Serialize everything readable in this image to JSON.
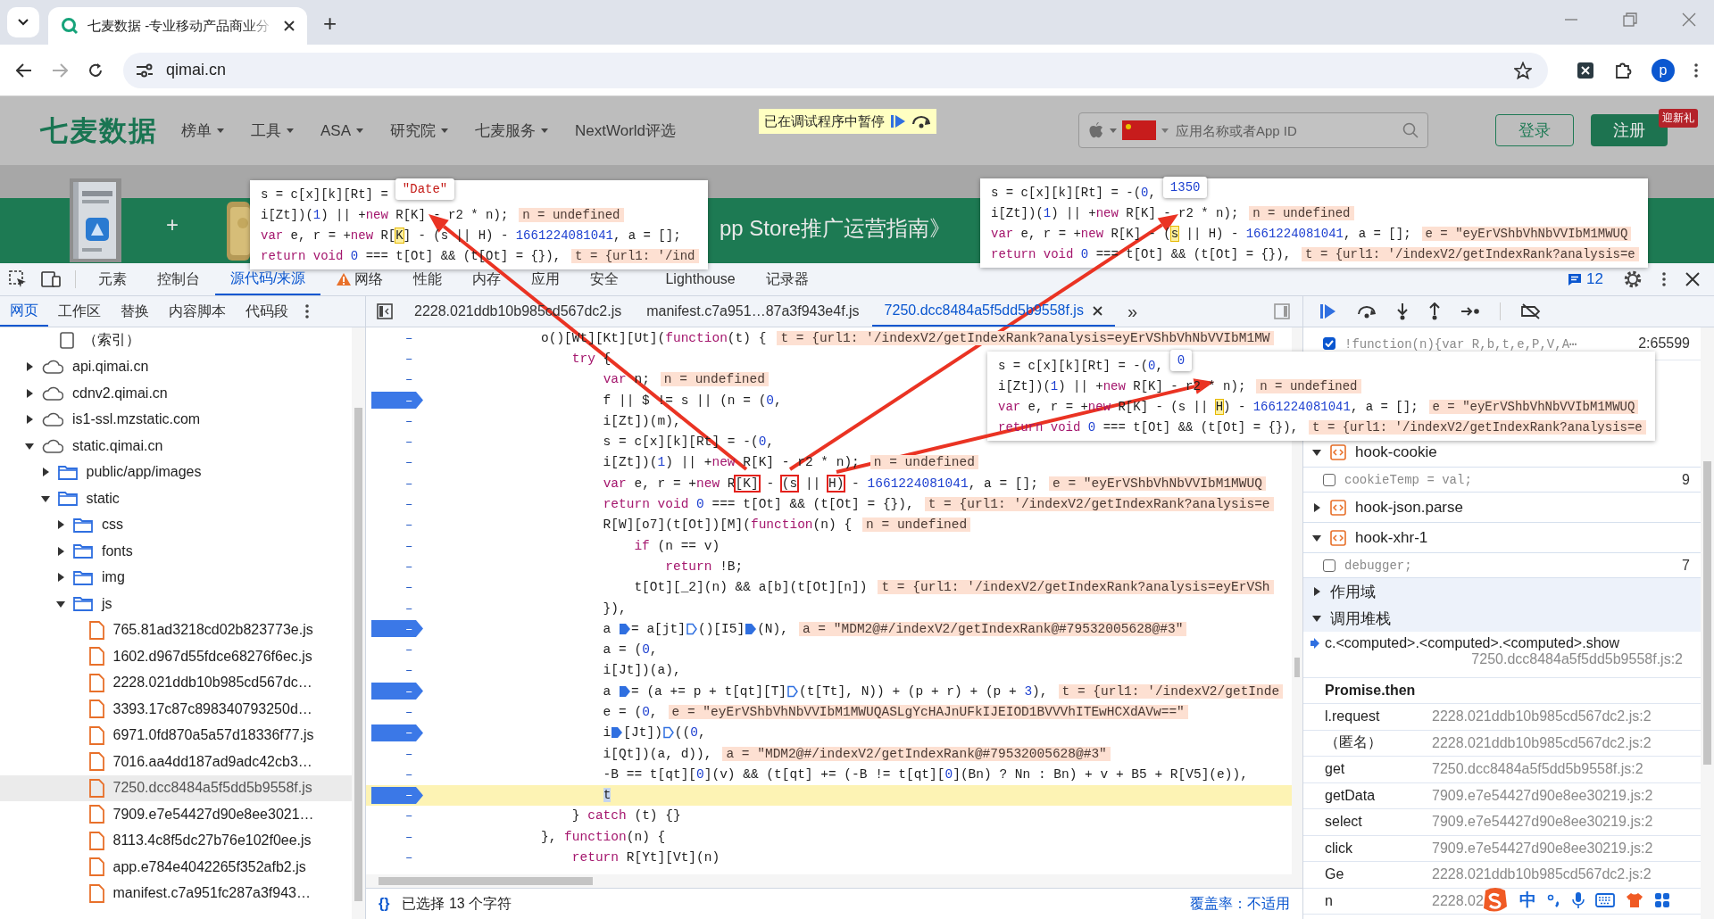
{
  "browser": {
    "tab": {
      "title": "七麦数据 -专业移动产品商业分"
    },
    "new_tab": "+",
    "address": "qimai.cn",
    "profile": "p"
  },
  "site": {
    "logo": "七麦数据",
    "nav": [
      {
        "label": "榜单",
        "dropdown": true
      },
      {
        "label": "工具",
        "dropdown": true
      },
      {
        "label": "ASA",
        "dropdown": true
      },
      {
        "label": "研究院",
        "dropdown": true
      },
      {
        "label": "七麦服务",
        "dropdown": true
      },
      {
        "label": "NextWorld评选",
        "dropdown": false
      }
    ],
    "paused_banner": "已在调试程序中暂停",
    "search": {
      "placeholder": "应用名称或者App ID"
    },
    "login": "登录",
    "register": "注册",
    "register_badge": "迎新礼",
    "banner_plus": "+",
    "banner_title": "pp Store推广运营指南》"
  },
  "devtools": {
    "tabs": [
      {
        "label": "元素",
        "selected": false,
        "warning": false
      },
      {
        "label": "控制台",
        "selected": false,
        "warning": false
      },
      {
        "label": "源代码/来源",
        "selected": true,
        "warning": false
      },
      {
        "label": "网络",
        "selected": false,
        "warning": true
      },
      {
        "label": "性能",
        "selected": false,
        "warning": false
      },
      {
        "label": "内存",
        "selected": false,
        "warning": false
      },
      {
        "label": "应用",
        "selected": false,
        "warning": false
      },
      {
        "label": "安全",
        "selected": false,
        "warning": false
      },
      {
        "label": "Lighthouse",
        "selected": false,
        "warning": false
      },
      {
        "label": "记录器",
        "selected": false,
        "warning": false
      }
    ],
    "issues_count": "12"
  },
  "navigator": {
    "tabs": [
      {
        "label": "网页",
        "selected": true
      },
      {
        "label": "工作区",
        "selected": false
      },
      {
        "label": "替换",
        "selected": false
      },
      {
        "label": "内容脚本",
        "selected": false
      },
      {
        "label": "代码段",
        "selected": false
      }
    ],
    "tree": [
      {
        "label": "（索引）",
        "kind": "page",
        "selected": false
      },
      {
        "label": "api.qimai.cn",
        "kind": "domain",
        "expanded": false,
        "selected": false
      },
      {
        "label": "cdnv2.qimai.cn",
        "kind": "domain",
        "expanded": false,
        "selected": false
      },
      {
        "label": "is1-ssl.mzstatic.com",
        "kind": "domain",
        "expanded": false,
        "selected": false
      },
      {
        "label": "static.qimai.cn",
        "kind": "domain",
        "expanded": true,
        "selected": false,
        "children": [
          {
            "label": "public/app/images",
            "kind": "folder",
            "expanded": false,
            "selected": false
          },
          {
            "label": "static",
            "kind": "folder",
            "expanded": true,
            "selected": false,
            "children": [
              {
                "label": "css",
                "kind": "folder",
                "expanded": false,
                "selected": false
              },
              {
                "label": "fonts",
                "kind": "folder",
                "expanded": false,
                "selected": false
              },
              {
                "label": "img",
                "kind": "folder",
                "expanded": false,
                "selected": false
              },
              {
                "label": "js",
                "kind": "folder",
                "expanded": true,
                "selected": false,
                "children": [
                  {
                    "label": "765.81ad3218cd02b823773e.js",
                    "kind": "file",
                    "selected": false
                  },
                  {
                    "label": "1602.d967d55fdce68276f6ec.js",
                    "kind": "file",
                    "selected": false
                  },
                  {
                    "label": "2228.021ddb10b985cd567dc…",
                    "kind": "file",
                    "selected": false
                  },
                  {
                    "label": "3393.17c87c898340793250d…",
                    "kind": "file",
                    "selected": false
                  },
                  {
                    "label": "6971.0fd870a5a57d18336f77.js",
                    "kind": "file",
                    "selected": false
                  },
                  {
                    "label": "7016.aa4dd187ad9adc42cb3…",
                    "kind": "file",
                    "selected": false
                  },
                  {
                    "label": "7250.dcc8484a5f5dd5b9558f.js",
                    "kind": "file",
                    "selected": true
                  },
                  {
                    "label": "7909.e7e54427d90e8ee3021…",
                    "kind": "file",
                    "selected": false
                  },
                  {
                    "label": "8113.4c8f5dc27b76e102f0ee.js",
                    "kind": "file",
                    "selected": false
                  },
                  {
                    "label": "app.e784e4042265f352afb2.js",
                    "kind": "file",
                    "selected": false
                  },
                  {
                    "label": "manifest.c7a951fc287a3f943…",
                    "kind": "file",
                    "selected": false
                  }
                ]
              }
            ]
          }
        ]
      }
    ]
  },
  "editor": {
    "tabs": [
      {
        "label": "2228.021ddb10b985cd567dc2.js",
        "selected": false
      },
      {
        "label": "manifest.c7a951…87a3f943e4f.js",
        "selected": false
      },
      {
        "label": "7250.dcc8484a5f5dd5b9558f.js",
        "selected": true
      }
    ],
    "more": "»",
    "lines": [
      {
        "num": "–",
        "bp": false,
        "current": false,
        "code": [
          {
            "t": "o()[Wt][Kt][Ut]("
          },
          {
            "t": "function",
            "kind": "kw"
          },
          {
            "t": "(t) {"
          }
        ],
        "value": "t = {url1: '/indexV2/getIndexRank?analysis=eyErVShbVhNbVVIbM1MW"
      },
      {
        "num": "–",
        "bp": false,
        "current": false,
        "code": [
          {
            "t": "    try",
            "kind": "kw"
          },
          {
            "t": " {"
          }
        ]
      },
      {
        "num": "–",
        "bp": false,
        "current": false,
        "code": [
          {
            "t": "        var",
            "kind": "kw"
          },
          {
            "t": " n;"
          }
        ],
        "value": "n = undefined"
      },
      {
        "num": "–",
        "bp": true,
        "current": false,
        "code": [
          {
            "t": "        f || $ != s || (n = ("
          },
          {
            "t": "0",
            "kind": "num"
          },
          {
            "t": ","
          }
        ]
      },
      {
        "num": "–",
        "bp": false,
        "current": false,
        "code": [
          {
            "t": "        i[Zt])(m),"
          }
        ]
      },
      {
        "num": "–",
        "bp": false,
        "current": false,
        "code": [
          {
            "t": "        s = c[x][k][Rt] = -("
          },
          {
            "t": "0",
            "kind": "num"
          },
          {
            "t": ","
          }
        ]
      },
      {
        "num": "–",
        "bp": false,
        "current": false,
        "code": [
          {
            "t": "        i[Zt])("
          },
          {
            "t": "1",
            "kind": "num"
          },
          {
            "t": ") || +"
          },
          {
            "t": "new",
            "kind": "kw"
          },
          {
            "t": " R[K] - r2 * n);"
          }
        ],
        "value": "n = undefined"
      },
      {
        "num": "–",
        "bp": false,
        "current": false,
        "code": [
          {
            "t": "        var",
            "kind": "kw"
          },
          {
            "t": " e, r = +"
          },
          {
            "t": "new",
            "kind": "kw"
          },
          {
            "t": " R"
          },
          {
            "t": "[K]",
            "kind": "box"
          },
          {
            "t": " - "
          },
          {
            "t": "(s",
            "kind": "box"
          },
          {
            "t": " || "
          },
          {
            "t": "H)",
            "kind": "box"
          },
          {
            "t": " - "
          },
          {
            "t": "1661224081041",
            "kind": "num"
          },
          {
            "t": ", a = [];"
          }
        ],
        "value": "e = \"eyErVShbVhNbVVIbM1MWUQ"
      },
      {
        "num": "–",
        "bp": false,
        "current": false,
        "code": [
          {
            "t": "        return void",
            "kind": "kw"
          },
          {
            "t": " 0",
            "kind": "num"
          },
          {
            "t": " === t[Ot] && (t[Ot] = {}),"
          }
        ],
        "value": "t = {url1: '/indexV2/getIndexRank?analysis=e"
      },
      {
        "num": "–",
        "bp": false,
        "current": false,
        "code": [
          {
            "t": "        R[W][o7](t[Ot])[M]("
          },
          {
            "t": "function",
            "kind": "kw"
          },
          {
            "t": "(n) {"
          }
        ],
        "value": "n = undefined"
      },
      {
        "num": "–",
        "bp": false,
        "current": false,
        "code": [
          {
            "t": "            if",
            "kind": "kw"
          },
          {
            "t": " (n == v)"
          }
        ]
      },
      {
        "num": "–",
        "bp": false,
        "current": false,
        "code": [
          {
            "t": "                return",
            "kind": "kw"
          },
          {
            "t": " !B;"
          }
        ]
      },
      {
        "num": "–",
        "bp": false,
        "current": false,
        "code": [
          {
            "t": "            t[Ot][_2](n) && a[b](t[Ot][n])"
          }
        ],
        "value": "t = {url1: '/indexV2/getIndexRank?analysis=eyErVSh"
      },
      {
        "num": "–",
        "bp": false,
        "current": false,
        "code": [
          {
            "t": "        }),"
          }
        ]
      },
      {
        "num": "–",
        "bp": true,
        "current": false,
        "code": [
          {
            "t": "        a "
          },
          {
            "kind": "step"
          },
          {
            "t": "= a[jt]"
          },
          {
            "kind": "step-open"
          },
          {
            "t": "()[I5]"
          },
          {
            "kind": "step"
          },
          {
            "t": "(N),"
          }
        ],
        "value": "a = \"MDM2@#/indexV2/getIndexRank@#79532005628@#3\""
      },
      {
        "num": "–",
        "bp": false,
        "current": false,
        "code": [
          {
            "t": "        a = ("
          },
          {
            "t": "0",
            "kind": "num"
          },
          {
            "t": ","
          }
        ]
      },
      {
        "num": "–",
        "bp": false,
        "current": false,
        "code": [
          {
            "t": "        i[Jt])(a),"
          }
        ]
      },
      {
        "num": "–",
        "bp": true,
        "current": false,
        "code": [
          {
            "t": "        a "
          },
          {
            "kind": "step"
          },
          {
            "t": "= (a += p + t[qt][T]"
          },
          {
            "kind": "step-open"
          },
          {
            "t": "(t[Tt], N)) + (p + r) + (p + "
          },
          {
            "t": "3",
            "kind": "num"
          },
          {
            "t": "),"
          }
        ],
        "value": "t = {url1: '/indexV2/getInde"
      },
      {
        "num": "–",
        "bp": false,
        "current": false,
        "code": [
          {
            "t": "        e = ("
          },
          {
            "t": "0",
            "kind": "num"
          },
          {
            "t": ","
          }
        ],
        "value": "e = \"eyErVShbVhNbVVIbM1MWUQASLgYcHAJnUFkIJEIOD1BVVVhITEwHCXdAVw==\""
      },
      {
        "num": "–",
        "bp": true,
        "current": false,
        "code": [
          {
            "t": "        i"
          },
          {
            "kind": "step"
          },
          {
            "t": "[Jt])"
          },
          {
            "kind": "step-open"
          },
          {
            "t": "(("
          },
          {
            "t": "0",
            "kind": "num"
          },
          {
            "t": ","
          }
        ]
      },
      {
        "num": "–",
        "bp": false,
        "current": false,
        "code": [
          {
            "t": "        i[Qt])(a, d)),"
          }
        ],
        "value": "a = \"MDM2@#/indexV2/getIndexRank@#79532005628@#3\""
      },
      {
        "num": "–",
        "bp": false,
        "current": false,
        "code": [
          {
            "t": "        -B == t[qt]["
          },
          {
            "t": "0",
            "kind": "num"
          },
          {
            "t": "](v) && (t[qt] += (-B != t[qt]["
          },
          {
            "t": "0",
            "kind": "num"
          },
          {
            "t": "](Bn) ? Nn : Bn) + v + B5 + R[V5](e)),"
          }
        ]
      },
      {
        "num": "–",
        "bp": true,
        "current": true,
        "code": [
          {
            "t": "        t",
            "kind": "sel"
          }
        ]
      },
      {
        "num": "–",
        "bp": false,
        "current": false,
        "code": [
          {
            "t": "    } "
          },
          {
            "t": "catch",
            "kind": "kw"
          },
          {
            "t": " (t) {}"
          }
        ]
      },
      {
        "num": "–",
        "bp": false,
        "current": false,
        "code": [
          {
            "t": "}, "
          },
          {
            "t": "function",
            "kind": "kw"
          },
          {
            "t": "(n) {"
          }
        ]
      },
      {
        "num": "–",
        "bp": false,
        "current": false,
        "code": [
          {
            "t": "    return",
            "kind": "kw"
          },
          {
            "t": " R[Yt][Vt](n)"
          }
        ]
      }
    ],
    "status": {
      "format": "{}",
      "selection": "已选择 13 个字符",
      "coverage": "覆盖率：不适用"
    }
  },
  "popovers": [
    {
      "bubble": {
        "text": "\"Date\"",
        "kind": "string"
      },
      "lines": [
        {
          "code": [
            {
              "t": "s = c[x][k][Rt] ="
            }
          ]
        },
        {
          "code": [
            {
              "t": "i[Zt])("
            },
            {
              "t": "1",
              "kind": "num"
            },
            {
              "t": ") || +"
            },
            {
              "t": "new",
              "kind": "kw"
            },
            {
              "t": " R[K] - r2 * n);"
            }
          ],
          "value": "n = undefined"
        },
        {
          "code": [
            {
              "t": "var",
              "kind": "kw"
            },
            {
              "t": " e, r = +"
            },
            {
              "t": "new",
              "kind": "kw"
            },
            {
              "t": " R["
            },
            {
              "t": "K",
              "kind": "hl"
            },
            {
              "t": "] - (s || H) - "
            },
            {
              "t": "1661224081041",
              "kind": "num"
            },
            {
              "t": ", a = [];"
            }
          ]
        },
        {
          "code": [
            {
              "t": "return void",
              "kind": "kw"
            },
            {
              "t": " 0",
              "kind": "num"
            },
            {
              "t": " === t[Ot] && (t[Ot] = {}),"
            }
          ],
          "value": "t = {url1: '/ind"
        }
      ]
    },
    {
      "bubble": {
        "text": "1350",
        "kind": "number"
      },
      "lines": [
        {
          "code": [
            {
              "t": "s = c[x][k][Rt] = -("
            },
            {
              "t": "0",
              "kind": "num"
            },
            {
              "t": ","
            }
          ]
        },
        {
          "code": [
            {
              "t": "i[Zt])("
            },
            {
              "t": "1",
              "kind": "num"
            },
            {
              "t": ") || +"
            },
            {
              "t": "new",
              "kind": "kw"
            },
            {
              "t": " R[K] - r2 * n);"
            }
          ],
          "value": "n = undefined"
        },
        {
          "code": [
            {
              "t": "var",
              "kind": "kw"
            },
            {
              "t": " e, r = +"
            },
            {
              "t": "new",
              "kind": "kw"
            },
            {
              "t": " R[K] - ("
            },
            {
              "t": "s",
              "kind": "hl"
            },
            {
              "t": " || H) - "
            },
            {
              "t": "1661224081041",
              "kind": "num"
            },
            {
              "t": ", a = [];"
            }
          ],
          "value": "e = \"eyErVShbVhNbVVIbM1MWUQ"
        },
        {
          "code": [
            {
              "t": "return void",
              "kind": "kw"
            },
            {
              "t": " 0",
              "kind": "num"
            },
            {
              "t": " === t[Ot] && (t[Ot] = {}),"
            }
          ],
          "value": "t = {url1: '/indexV2/getIndexRank?analysis=e"
        }
      ]
    },
    {
      "bubble": {
        "text": "0",
        "kind": "number"
      },
      "lines": [
        {
          "code": [
            {
              "t": "s = c[x][k][Rt] = -("
            },
            {
              "t": "0",
              "kind": "num"
            },
            {
              "t": ","
            }
          ]
        },
        {
          "code": [
            {
              "t": "i[Zt])("
            },
            {
              "t": "1",
              "kind": "num"
            },
            {
              "t": ") || +"
            },
            {
              "t": "new",
              "kind": "kw"
            },
            {
              "t": " R[K] - r2 * n);"
            }
          ],
          "value": "n = undefined"
        },
        {
          "code": [
            {
              "t": "var",
              "kind": "kw"
            },
            {
              "t": " e, r = +"
            },
            {
              "t": "new",
              "kind": "kw"
            },
            {
              "t": " R[K] - (s || "
            },
            {
              "t": "H",
              "kind": "hl"
            },
            {
              "t": ") - "
            },
            {
              "t": "1661224081041",
              "kind": "num"
            },
            {
              "t": ", a = [];"
            }
          ],
          "value": "e = \"eyErVShbVhNbVVIbM1MWUQ"
        },
        {
          "code": [
            {
              "t": "return void",
              "kind": "kw"
            },
            {
              "t": " 0",
              "kind": "num"
            },
            {
              "t": " === t[Ot] && (t[Ot] = {}),"
            }
          ],
          "value": "t = {url1: '/indexV2/getIndexRank?analysis=e"
        }
      ]
    }
  ],
  "debugger": {
    "breakpoints": [
      {
        "code": "!function(n){var R,b,t,e,P,V,A⋯",
        "line": "2:65599",
        "checked": true
      }
    ],
    "snippet_groups": [
      {
        "name": "hook-cookie",
        "expanded": true,
        "breakpoints": [
          {
            "code": "cookieTemp = val;",
            "line": "9",
            "checked": false
          }
        ]
      },
      {
        "name": "hook-json.parse",
        "expanded": false
      },
      {
        "name": "hook-xhr-1",
        "expanded": true,
        "breakpoints": [
          {
            "code": "debugger;",
            "line": "7",
            "checked": false
          }
        ]
      }
    ],
    "sections": [
      {
        "title": "作用域",
        "expanded": false
      },
      {
        "title": "调用堆栈",
        "expanded": true
      }
    ],
    "call_stack": [
      {
        "kind": "frame",
        "function": "c.<computed>.<computed>.<computed>.show",
        "location": "7250.dcc8484a5f5dd5b9558f.js:2",
        "selected": true
      },
      {
        "kind": "async",
        "function": "Promise.then"
      },
      {
        "kind": "frame",
        "function": "l.request",
        "location": "2228.021ddb10b985cd567dc2.js:2",
        "selected": false
      },
      {
        "kind": "frame",
        "function": "（匿名）",
        "location": "2228.021ddb10b985cd567dc2.js:2",
        "selected": false
      },
      {
        "kind": "frame",
        "function": "get",
        "location": "7250.dcc8484a5f5dd5b9558f.js:2",
        "selected": false
      },
      {
        "kind": "frame",
        "function": "getData",
        "location": "7909.e7e54427d90e8ee30219.js:2",
        "selected": false
      },
      {
        "kind": "frame",
        "function": "select",
        "location": "7909.e7e54427d90e8ee30219.js:2",
        "selected": false
      },
      {
        "kind": "frame",
        "function": "click",
        "location": "7909.e7e54427d90e8ee30219.js:2",
        "selected": false
      },
      {
        "kind": "frame",
        "function": "Ge",
        "location": "2228.021ddb10b985cd567dc2.js:2",
        "selected": false
      },
      {
        "kind": "frame",
        "function": "n",
        "location": "2228.02",
        "selected": false
      }
    ]
  },
  "ime": {
    "mode": "中"
  }
}
